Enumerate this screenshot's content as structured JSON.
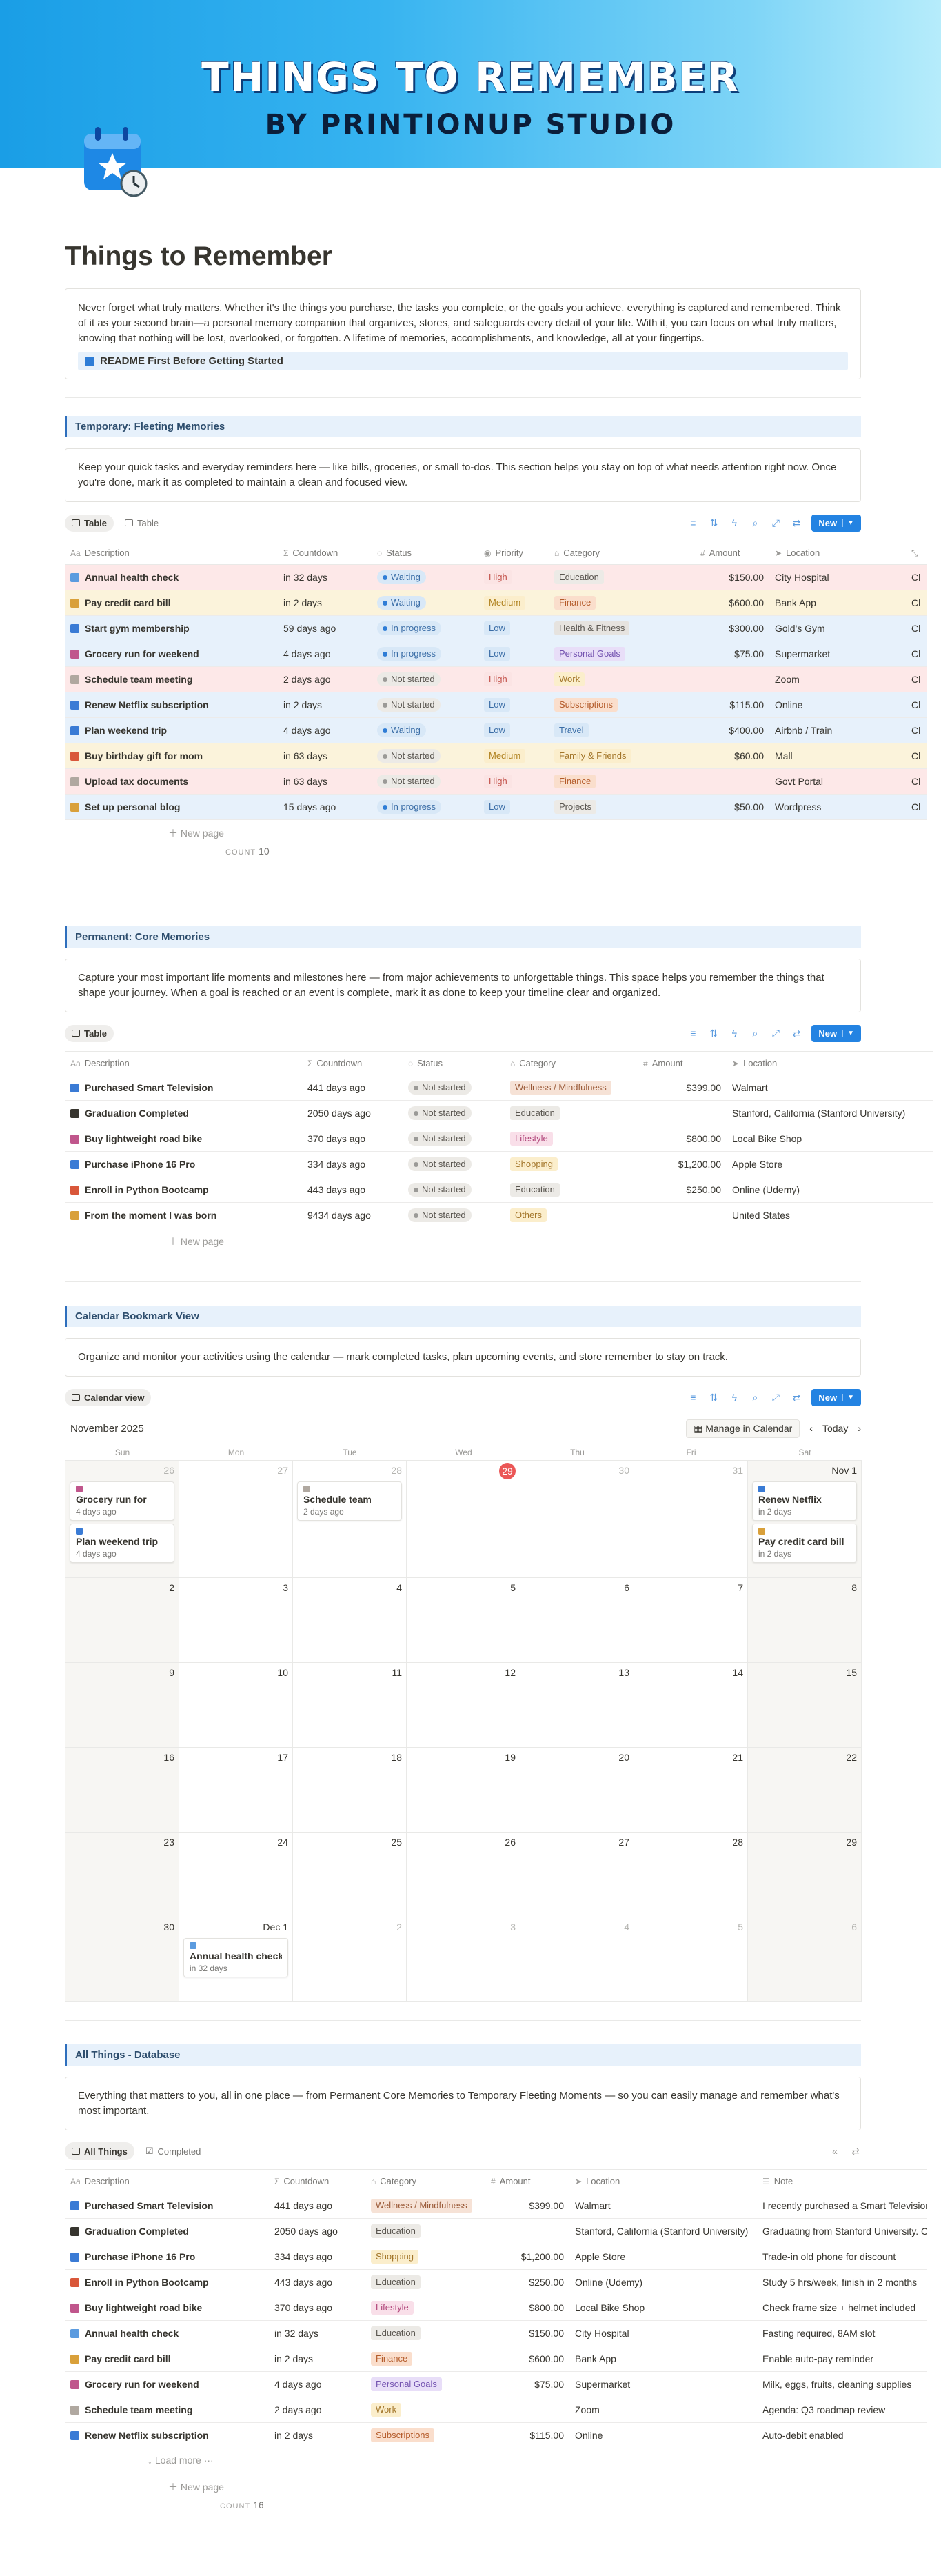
{
  "banner": {
    "title": "THINGS TO REMEMBER",
    "subtitle": "BY PRINTIONUP STUDIO"
  },
  "page": {
    "title": "Things to Remember",
    "intro": "Never forget what truly matters. Whether it's the things you purchase, the tasks you complete, or the goals you achieve, everything is captured and remembered. Think of it as your second brain—a personal memory companion that organizes, stores, and safeguards every detail of your life. With it, you can focus on what truly matters, knowing that nothing will be lost, overlooked, or forgotten. A lifetime of memories, accomplishments, and knowledge, all at your fingertips.",
    "readme": "README First Before Getting Started"
  },
  "colors": {
    "accent": "#2383e2",
    "red_row": "#fde8e8",
    "yellow_row": "#fbf3db",
    "blue_row": "#e7f1fb"
  },
  "temporary": {
    "header": "Temporary: Fleeting Memories",
    "desc": "Keep your quick tasks and everyday reminders here — like bills, groceries, or small to-dos. This section helps you stay on top of what needs attention right now. Once you're done, mark it as completed to maintain a clean and focused view.",
    "tabs": [
      "Table",
      "Table"
    ],
    "new_label": "New",
    "columns": [
      "Description",
      "Countdown",
      "Status",
      "Priority",
      "Category",
      "Amount",
      "Location",
      "Cl"
    ],
    "rows": [
      {
        "desc": "Annual health check",
        "countdown": "in 32 days",
        "status": "Waiting",
        "priority": "High",
        "category": "Education",
        "amount": "$150.00",
        "location": "City Hospital",
        "extra": "Cl",
        "tone": "red",
        "icon": "#5b9bdf"
      },
      {
        "desc": "Pay credit card bill",
        "countdown": "in 2 days",
        "status": "Waiting",
        "priority": "Medium",
        "category": "Finance",
        "amount": "$600.00",
        "location": "Bank App",
        "extra": "Cl",
        "tone": "yellow",
        "icon": "#d9a03a"
      },
      {
        "desc": "Start gym membership",
        "countdown": "59 days ago",
        "status": "In progress",
        "priority": "Low",
        "category": "Health & Fitness",
        "amount": "$300.00",
        "location": "Gold's Gym",
        "extra": "Cl",
        "tone": "blue",
        "icon": "#3a7bd5"
      },
      {
        "desc": "Grocery run for weekend",
        "countdown": "4 days ago",
        "status": "In progress",
        "priority": "Low",
        "category": "Personal Goals",
        "amount": "$75.00",
        "location": "Supermarket",
        "extra": "Cl",
        "tone": "blue",
        "icon": "#c0568c"
      },
      {
        "desc": "Schedule team meeting",
        "countdown": "2 days ago",
        "status": "Not started",
        "priority": "High",
        "category": "Work",
        "amount": "",
        "location": "Zoom",
        "extra": "Cl",
        "tone": "red",
        "icon": "#b0a8a0"
      },
      {
        "desc": "Renew Netflix subscription",
        "countdown": "in 2 days",
        "status": "Not started",
        "priority": "Low",
        "category": "Subscriptions",
        "amount": "$115.00",
        "location": "Online",
        "extra": "Cl",
        "tone": "blue",
        "icon": "#3a7bd5"
      },
      {
        "desc": "Plan weekend trip",
        "countdown": "4 days ago",
        "status": "Waiting",
        "priority": "Low",
        "category": "Travel",
        "amount": "$400.00",
        "location": "Airbnb / Train",
        "extra": "Cl",
        "tone": "blue",
        "icon": "#3a7bd5"
      },
      {
        "desc": "Buy birthday gift for mom",
        "countdown": "in 63 days",
        "status": "Not started",
        "priority": "Medium",
        "category": "Family & Friends",
        "amount": "$60.00",
        "location": "Mall",
        "extra": "Cl",
        "tone": "yellow",
        "icon": "#d9573a"
      },
      {
        "desc": "Upload tax documents",
        "countdown": "in 63 days",
        "status": "Not started",
        "priority": "High",
        "category": "Finance",
        "amount": "",
        "location": "Govt Portal",
        "extra": "Cl",
        "tone": "red",
        "icon": "#b0a8a0"
      },
      {
        "desc": "Set up personal blog",
        "countdown": "15 days ago",
        "status": "In progress",
        "priority": "Low",
        "category": "Projects",
        "amount": "$50.00",
        "location": "Wordpress",
        "extra": "Cl",
        "tone": "blue",
        "icon": "#d9a03a"
      }
    ],
    "new_page": "New page",
    "count_label": "COUNT",
    "count": "10"
  },
  "permanent": {
    "header": "Permanent: Core Memories",
    "desc": "Capture your most important life moments and milestones here — from major achievements to unforgettable things. This space helps you remember the things that shape your journey. When a goal is reached or an event is complete, mark it as done to keep your timeline clear and organized.",
    "tabs": [
      "Table"
    ],
    "new_label": "New",
    "columns": [
      "Description",
      "Countdown",
      "Status",
      "Category",
      "Amount",
      "Location"
    ],
    "rows": [
      {
        "desc": "Purchased Smart Television",
        "countdown": "441 days ago",
        "status": "Not started",
        "category": "Wellness / Mindfulness",
        "amount": "$399.00",
        "location": "Walmart",
        "icon": "#3a7bd5"
      },
      {
        "desc": "Graduation Completed",
        "countdown": "2050 days ago",
        "status": "Not started",
        "category": "Education",
        "amount": "",
        "location": "Stanford, California (Stanford University)",
        "icon": "#37352f"
      },
      {
        "desc": "Buy lightweight road bike",
        "countdown": "370 days ago",
        "status": "Not started",
        "category": "Lifestyle",
        "amount": "$800.00",
        "location": "Local Bike Shop",
        "icon": "#c0568c"
      },
      {
        "desc": "Purchase iPhone 16 Pro",
        "countdown": "334 days ago",
        "status": "Not started",
        "category": "Shopping",
        "amount": "$1,200.00",
        "location": "Apple Store",
        "icon": "#3a7bd5"
      },
      {
        "desc": "Enroll in Python Bootcamp",
        "countdown": "443 days ago",
        "status": "Not started",
        "category": "Education",
        "amount": "$250.00",
        "location": "Online (Udemy)",
        "icon": "#d9573a"
      },
      {
        "desc": "From the moment I was born",
        "countdown": "9434 days ago",
        "status": "Not started",
        "category": "Others",
        "amount": "",
        "location": "United States",
        "icon": "#d9a03a"
      }
    ],
    "new_page": "New page"
  },
  "calendar": {
    "header": "Calendar Bookmark View",
    "desc": "Organize and monitor your activities using the calendar — mark completed tasks, plan upcoming events, and store remember to stay on track.",
    "tab": "Calendar view",
    "new_label": "New",
    "month": "November 2025",
    "manage": "Manage in Calendar",
    "today": "Today",
    "weekdays": [
      "Sun",
      "Mon",
      "Tue",
      "Wed",
      "Thu",
      "Fri",
      "Sat"
    ],
    "weeks": [
      [
        {
          "d": "26",
          "mute": true,
          "events": [
            {
              "t": "Grocery run for",
              "s": "4 days ago",
              "c": "#c0568c"
            },
            {
              "t": "Plan weekend trip",
              "s": "4 days ago",
              "c": "#3a7bd5"
            }
          ]
        },
        {
          "d": "27",
          "mute": true,
          "events": []
        },
        {
          "d": "28",
          "mute": true,
          "events": [
            {
              "t": "Schedule team",
              "s": "2 days ago",
              "c": "#b0a8a0"
            }
          ]
        },
        {
          "d": "29",
          "today": true,
          "events": []
        },
        {
          "d": "30",
          "mute": true,
          "events": []
        },
        {
          "d": "31",
          "mute": true,
          "events": []
        },
        {
          "d": "Nov 1",
          "events": [
            {
              "t": "Renew Netflix",
              "s": "in 2 days",
              "c": "#3a7bd5"
            },
            {
              "t": "Pay credit card bill",
              "s": "in 2 days",
              "c": "#d9a03a"
            }
          ]
        }
      ],
      [
        {
          "d": "2"
        },
        {
          "d": "3"
        },
        {
          "d": "4"
        },
        {
          "d": "5"
        },
        {
          "d": "6"
        },
        {
          "d": "7"
        },
        {
          "d": "8"
        }
      ],
      [
        {
          "d": "9"
        },
        {
          "d": "10"
        },
        {
          "d": "11"
        },
        {
          "d": "12"
        },
        {
          "d": "13"
        },
        {
          "d": "14"
        },
        {
          "d": "15"
        }
      ],
      [
        {
          "d": "16"
        },
        {
          "d": "17"
        },
        {
          "d": "18"
        },
        {
          "d": "19"
        },
        {
          "d": "20"
        },
        {
          "d": "21"
        },
        {
          "d": "22"
        }
      ],
      [
        {
          "d": "23"
        },
        {
          "d": "24"
        },
        {
          "d": "25"
        },
        {
          "d": "26"
        },
        {
          "d": "27"
        },
        {
          "d": "28"
        },
        {
          "d": "29"
        }
      ],
      [
        {
          "d": "30"
        },
        {
          "d": "Dec 1",
          "events": [
            {
              "t": "Annual health check",
              "s": "in 32 days",
              "c": "#5b9bdf"
            }
          ]
        },
        {
          "d": "2",
          "mute": true
        },
        {
          "d": "3",
          "mute": true
        },
        {
          "d": "4",
          "mute": true
        },
        {
          "d": "5",
          "mute": true
        },
        {
          "d": "6",
          "mute": true
        }
      ]
    ]
  },
  "all": {
    "header": "All Things - Database",
    "desc": "Everything that matters to you, all in one place — from Permanent Core Memories to Temporary Fleeting Moments — so you can easily manage and remember what's most important.",
    "tabs": [
      "All Things",
      "Completed"
    ],
    "columns": [
      "Description",
      "Countdown",
      "Category",
      "Amount",
      "Location",
      "Note"
    ],
    "rows": [
      {
        "desc": "Purchased Smart Television",
        "countdown": "441 days ago",
        "category": "Wellness / Mindfulness",
        "amount": "$399.00",
        "location": "Walmart",
        "note": "I recently purchased a Smart Television to",
        "icon": "#3a7bd5"
      },
      {
        "desc": "Graduation Completed",
        "countdown": "2050 days ago",
        "category": "Education",
        "amount": "",
        "location": "Stanford, California (Stanford University)",
        "note": "Graduating from Stanford University. Calif",
        "icon": "#37352f"
      },
      {
        "desc": "Purchase iPhone 16 Pro",
        "countdown": "334 days ago",
        "category": "Shopping",
        "amount": "$1,200.00",
        "location": "Apple Store",
        "note": "Trade-in old phone for discount",
        "icon": "#3a7bd5"
      },
      {
        "desc": "Enroll in Python Bootcamp",
        "countdown": "443 days ago",
        "category": "Education",
        "amount": "$250.00",
        "location": "Online (Udemy)",
        "note": "Study 5 hrs/week, finish in 2 months",
        "icon": "#d9573a"
      },
      {
        "desc": "Buy lightweight road bike",
        "countdown": "370 days ago",
        "category": "Lifestyle",
        "amount": "$800.00",
        "location": "Local Bike Shop",
        "note": "Check frame size + helmet included",
        "icon": "#c0568c"
      },
      {
        "desc": "Annual health check",
        "countdown": "in 32 days",
        "category": "Education",
        "amount": "$150.00",
        "location": "City Hospital",
        "note": "Fasting required, 8AM slot",
        "icon": "#5b9bdf"
      },
      {
        "desc": "Pay credit card bill",
        "countdown": "in 2 days",
        "category": "Finance",
        "amount": "$600.00",
        "location": "Bank App",
        "note": "Enable auto-pay reminder",
        "icon": "#d9a03a"
      },
      {
        "desc": "Grocery run for weekend",
        "countdown": "4 days ago",
        "category": "Personal Goals",
        "amount": "$75.00",
        "location": "Supermarket",
        "note": "Milk, eggs, fruits, cleaning supplies",
        "icon": "#c0568c"
      },
      {
        "desc": "Schedule team meeting",
        "countdown": "2 days ago",
        "category": "Work",
        "amount": "",
        "location": "Zoom",
        "note": "Agenda: Q3 roadmap review",
        "icon": "#b0a8a0"
      },
      {
        "desc": "Renew Netflix subscription",
        "countdown": "in 2 days",
        "category": "Subscriptions",
        "amount": "$115.00",
        "location": "Online",
        "note": "Auto-debit enabled",
        "icon": "#3a7bd5"
      }
    ],
    "load_more": "Load more",
    "new_page": "New page",
    "count_label": "COUNT",
    "count": "16"
  },
  "pill_colors": {
    "High": [
      "#fbe4e4",
      "#c4554d"
    ],
    "Medium": [
      "#fbeecc",
      "#b0821f"
    ],
    "Low": [
      "#d8e8f7",
      "#3a6da6"
    ],
    "Education": [
      "#eceae6",
      "#5a5650"
    ],
    "Finance": [
      "#fadecc",
      "#b45b2a"
    ],
    "Health & Fitness": [
      "#e6e3df",
      "#5a5650"
    ],
    "Personal Goals": [
      "#e8def8",
      "#7352b0"
    ],
    "Work": [
      "#fbeecc",
      "#a3762a"
    ],
    "Subscriptions": [
      "#fadecc",
      "#b45b2a"
    ],
    "Travel": [
      "#d8e8f7",
      "#3a6da6"
    ],
    "Family & Friends": [
      "#fbeecc",
      "#a3762a"
    ],
    "Projects": [
      "#eceae6",
      "#5a5650"
    ],
    "Wellness / Mindfulness": [
      "#f6e2d6",
      "#9a5a38"
    ],
    "Lifestyle": [
      "#f9dfe9",
      "#b0467a"
    ],
    "Shopping": [
      "#fbeecc",
      "#a3762a"
    ],
    "Others": [
      "#fbeecc",
      "#a3762a"
    ]
  },
  "status_colors": {
    "Waiting": [
      "#d8e8f7",
      "#3a6da6",
      "#2f7dd6"
    ],
    "In progress": [
      "#d8e8f7",
      "#3a6da6",
      "#2f7dd6"
    ],
    "Not started": [
      "#eceae6",
      "#5a5650",
      "#9b9a97"
    ]
  }
}
